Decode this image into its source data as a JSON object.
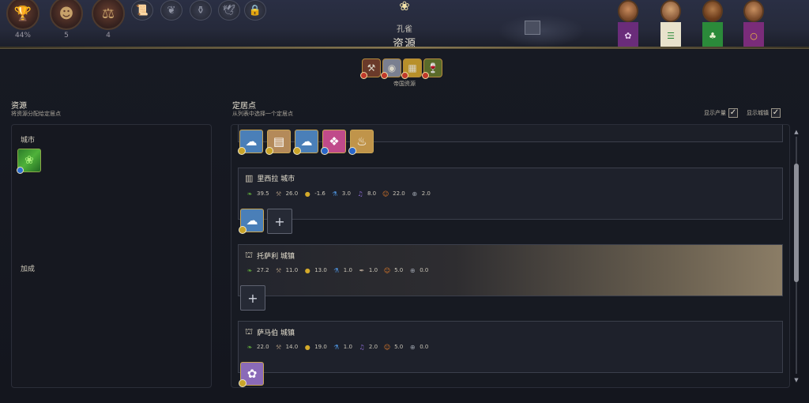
{
  "hud": {
    "stats": [
      {
        "icon": "trophy-icon",
        "glyph": "🏆",
        "value": "44%"
      },
      {
        "icon": "leader-portrait-icon",
        "glyph": "☻",
        "value": "5"
      },
      {
        "icon": "balance-scale-icon",
        "glyph": "⚖",
        "value": "4"
      }
    ],
    "slots": [
      {
        "icon": "scroll-icon",
        "glyph": "📜"
      },
      {
        "icon": "leaf-icon",
        "glyph": "❦"
      },
      {
        "icon": "amphora-icon",
        "glyph": "⚱"
      },
      {
        "icon": "dove-icon",
        "glyph": "🕊"
      },
      {
        "icon": "lock-icon",
        "glyph": "🔒"
      }
    ],
    "leader_name": "孔雀",
    "screen_title": "资源",
    "leader_banners": [
      {
        "color": "#6a2c7a",
        "glyph": "✿"
      },
      {
        "color": "#e8e2cc",
        "glyph": "☰"
      },
      {
        "color": "#2b8a3a",
        "glyph": "♣"
      },
      {
        "color": "#7a2c7a",
        "glyph": "○"
      }
    ],
    "close_glyph": "✕"
  },
  "empire": {
    "label": "帝国资源",
    "icons": [
      {
        "icon": "iron-icon",
        "glyph": "⚒",
        "color": "#6a3a2a"
      },
      {
        "icon": "silver-icon",
        "glyph": "◉",
        "color": "#7a7f90"
      },
      {
        "icon": "gold-bars-icon",
        "glyph": "▦",
        "color": "#b8902a"
      },
      {
        "icon": "wine-icon",
        "glyph": "🍷",
        "color": "#5a6a2a"
      }
    ]
  },
  "left": {
    "title": "资源",
    "subtitle": "将资源分配给定居点",
    "city_label": "城市",
    "bonus_label": "加成",
    "city_resource": {
      "icon": "dye-plant-resource-icon",
      "glyph": "❀"
    }
  },
  "right": {
    "title": "定居点",
    "subtitle": "从列表中选择一个定居点",
    "toggles": [
      {
        "label": "显示产量",
        "checked": "✓"
      },
      {
        "label": "显示城镇",
        "checked": "✓"
      }
    ],
    "top_strip_resources": [
      {
        "icon": "cotton-resource-icon",
        "glyph": "☁",
        "bg": "#4a7fb8",
        "badge": "gold"
      },
      {
        "icon": "salt-resource-icon",
        "glyph": "▤",
        "bg": "#b48a5a",
        "badge": "gold"
      },
      {
        "icon": "cotton-resource-icon",
        "glyph": "☁",
        "bg": "#4a7fb8",
        "badge": "gold"
      },
      {
        "icon": "silk-resource-icon",
        "glyph": "❖",
        "bg": "#c04a8a",
        "badge": "blue"
      },
      {
        "icon": "incense-resource-icon",
        "glyph": "♨",
        "bg": "#c0944a",
        "badge": "blue"
      }
    ],
    "settlements": [
      {
        "name": "里西拉 城市",
        "type_icon": "city-icon",
        "type_glyph": "▥",
        "yields": [
          {
            "icon": "food-icon",
            "glyph": "❧",
            "color": "#5ea83a",
            "value": "39.5"
          },
          {
            "icon": "production-icon",
            "glyph": "⚒",
            "color": "#8a7a6a",
            "value": "26.0"
          },
          {
            "icon": "gold-icon",
            "glyph": "●",
            "color": "#d4aa2a",
            "value": "-1.6"
          },
          {
            "icon": "science-icon",
            "glyph": "⚗",
            "color": "#4a8ad0",
            "value": "3.0"
          },
          {
            "icon": "culture-icon",
            "glyph": "♫",
            "color": "#8a6ad0",
            "value": "8.0"
          },
          {
            "icon": "happiness-icon",
            "glyph": "☺",
            "color": "#e07a2a",
            "value": "22.0"
          },
          {
            "icon": "influence-icon",
            "glyph": "⊕",
            "color": "#9aa0aa",
            "value": "2.0"
          }
        ],
        "resources": [
          {
            "icon": "cotton-resource-icon",
            "glyph": "☁",
            "bg": "#4a7fb8",
            "badge": "gold"
          }
        ],
        "has_add_slot": true
      },
      {
        "name": "托萨利 城镇",
        "type_icon": "town-icon",
        "type_glyph": "⛫",
        "yields": [
          {
            "icon": "food-icon",
            "glyph": "❧",
            "color": "#5ea83a",
            "value": "27.2"
          },
          {
            "icon": "production-icon",
            "glyph": "⚒",
            "color": "#8a7a6a",
            "value": "11.0"
          },
          {
            "icon": "gold-icon",
            "glyph": "●",
            "color": "#d4aa2a",
            "value": "13.0"
          },
          {
            "icon": "science-icon",
            "glyph": "⚗",
            "color": "#4a8ad0",
            "value": "1.0"
          },
          {
            "icon": "culture-icon",
            "glyph": "✒",
            "color": "#b0a090",
            "value": "1.0"
          },
          {
            "icon": "happiness-icon",
            "glyph": "☺",
            "color": "#e07a2a",
            "value": "5.0"
          },
          {
            "icon": "influence-icon",
            "glyph": "⊕",
            "color": "#9aa0aa",
            "value": "0.0"
          }
        ],
        "resources": [],
        "has_add_slot": true,
        "highlight": true
      },
      {
        "name": "萨马伯 城镇",
        "type_icon": "town-icon",
        "type_glyph": "⛫",
        "yields": [
          {
            "icon": "food-icon",
            "glyph": "❧",
            "color": "#5ea83a",
            "value": "22.0"
          },
          {
            "icon": "production-icon",
            "glyph": "⚒",
            "color": "#8a7a6a",
            "value": "14.0"
          },
          {
            "icon": "gold-icon",
            "glyph": "●",
            "color": "#d4aa2a",
            "value": "19.0"
          },
          {
            "icon": "science-icon",
            "glyph": "⚗",
            "color": "#4a8ad0",
            "value": "1.0"
          },
          {
            "icon": "culture-icon",
            "glyph": "♫",
            "color": "#8a6ad0",
            "value": "2.0"
          },
          {
            "icon": "happiness-icon",
            "glyph": "☺",
            "color": "#e07a2a",
            "value": "5.0"
          },
          {
            "icon": "influence-icon",
            "glyph": "⊕",
            "color": "#9aa0aa",
            "value": "0.0"
          }
        ],
        "resources": [
          {
            "icon": "cotton-flower-resource-icon",
            "glyph": "✿",
            "bg": "#8a6ab8",
            "badge": "gold"
          }
        ],
        "has_add_slot": false
      }
    ],
    "add_glyph": "+"
  }
}
